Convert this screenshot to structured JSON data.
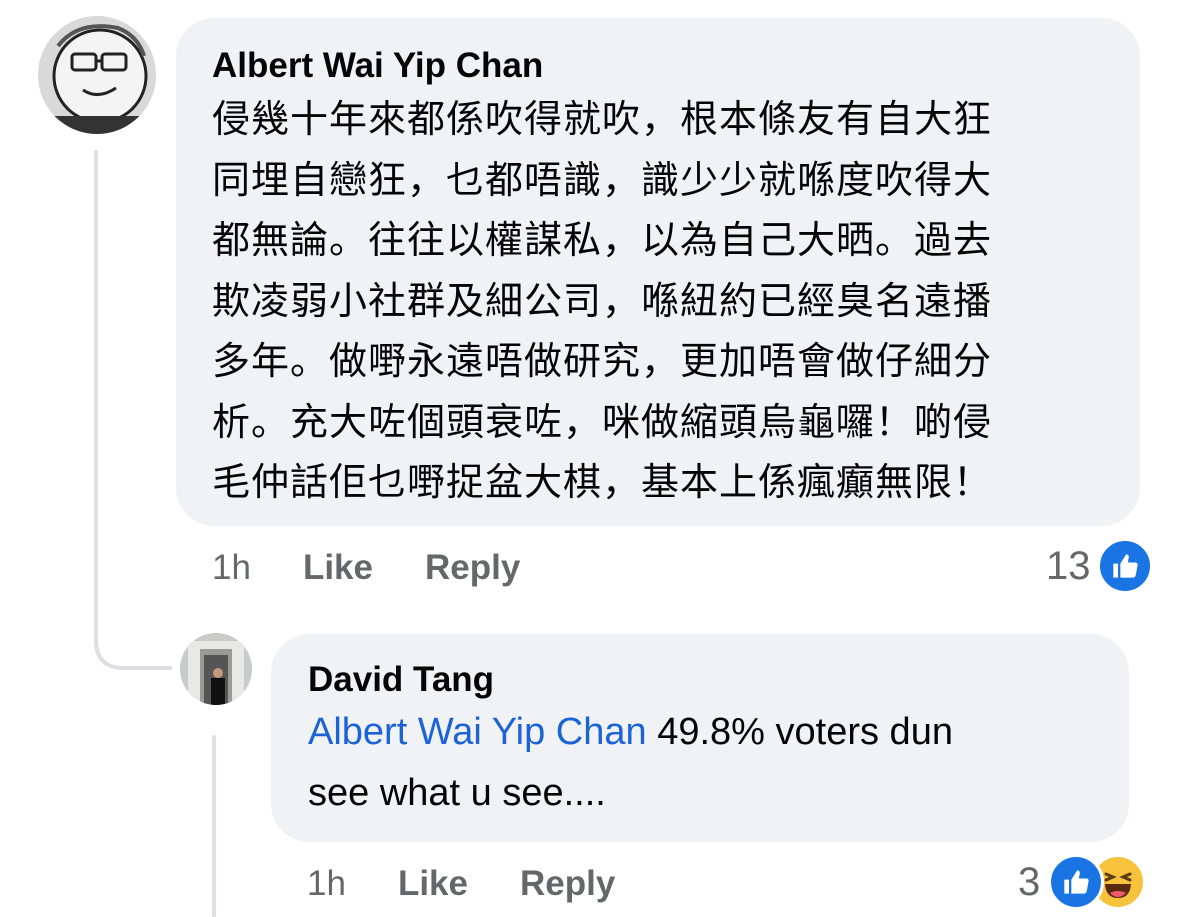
{
  "comments": [
    {
      "author": "Albert Wai Yip Chan",
      "lines": [
        "侵幾十年來都係吹得就吹，根本條友有自大狂",
        "同埋自戀狂，乜都唔識，識少少就喺度吹得大",
        "都無論。往往以權謀私，以為自己大晒。過去",
        "欺凌弱小社群及細公司，喺紐約已經臭名遠播",
        "多年。做嘢永遠唔做研究，更加唔會做仔細分",
        "析。充大咗個頭衰咗，咪做縮頭烏龜囉！啲侵",
        "毛仲話佢乜嘢捉盆大棋，基本上係瘋癲無限！"
      ],
      "time": "1h",
      "like_label": "Like",
      "reply_label": "Reply",
      "reaction_count": "13",
      "reactions": [
        "like-icon"
      ]
    },
    {
      "author": "David Tang",
      "mention": "Albert Wai Yip Chan",
      "text_line1": " 49.8% voters dun",
      "text_line2": "see what u see....",
      "time": "1h",
      "like_label": "Like",
      "reply_label": "Reply",
      "reaction_count": "3",
      "reactions": [
        "like-icon",
        "haha-icon"
      ]
    }
  ],
  "colors": {
    "bubble": "#f0f2f5",
    "mention": "#1c63d6",
    "secondary_text": "#65676b",
    "like_blue": "#1b74e4",
    "haha_yellow": "#f7c33d"
  }
}
